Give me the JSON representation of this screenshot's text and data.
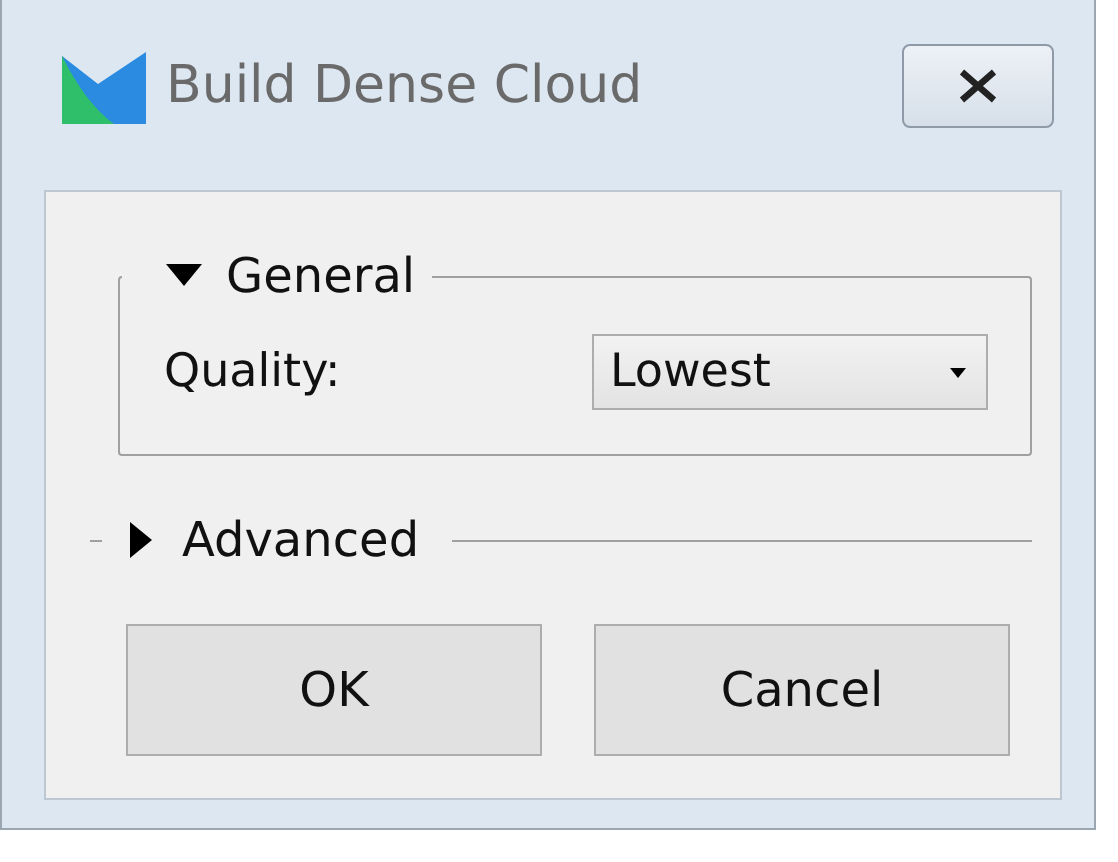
{
  "window": {
    "title": "Build Dense Cloud"
  },
  "sections": [
    {
      "title": "General",
      "expanded": true,
      "fields": [
        {
          "label": "Quality:",
          "value": "Lowest"
        }
      ]
    },
    {
      "title": "Advanced",
      "expanded": false
    }
  ],
  "buttons": [
    {
      "label": "OK"
    },
    {
      "label": "Cancel"
    }
  ]
}
